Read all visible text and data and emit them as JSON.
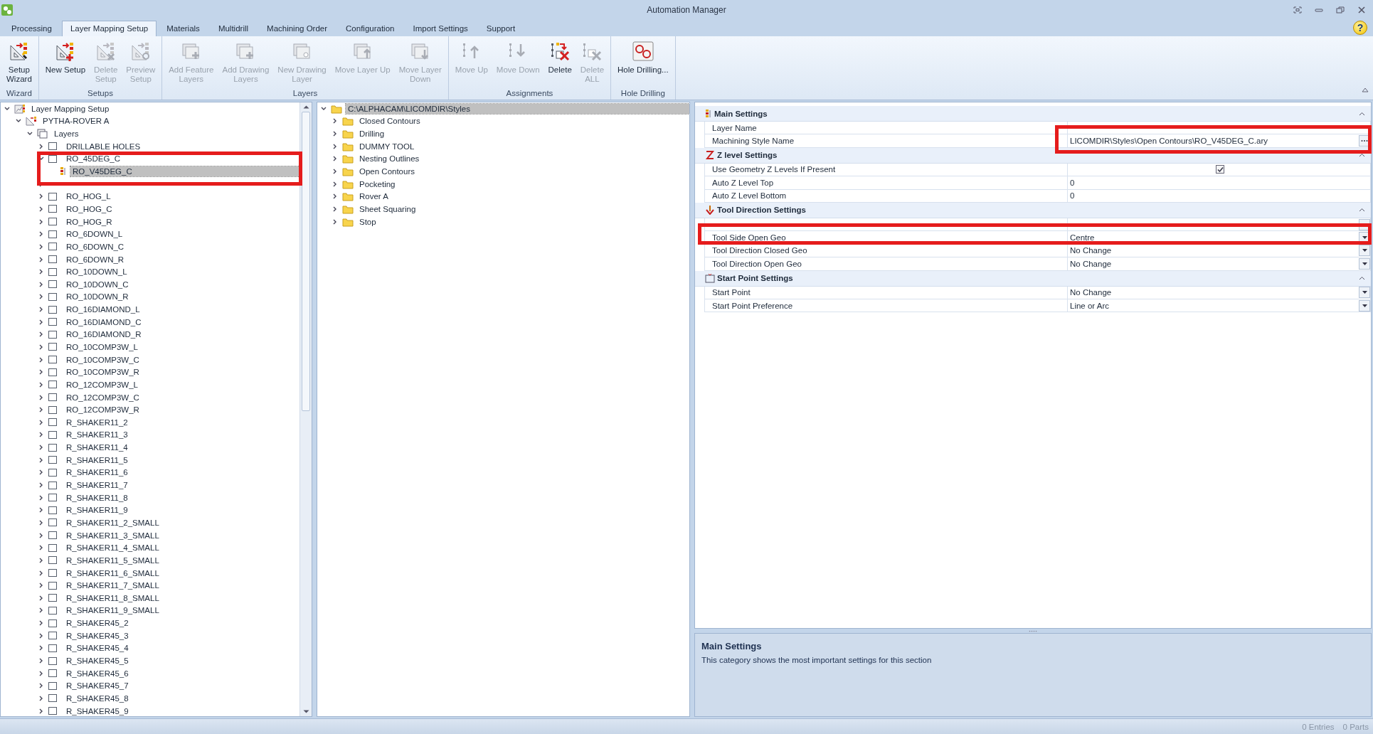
{
  "window": {
    "title": "Automation Manager"
  },
  "help": "?",
  "tabs": [
    {
      "label": "Processing",
      "selected": false
    },
    {
      "label": "Layer Mapping Setup",
      "selected": true
    },
    {
      "label": "Materials",
      "selected": false
    },
    {
      "label": "Multidrill",
      "selected": false
    },
    {
      "label": "Machining Order",
      "selected": false
    },
    {
      "label": "Configuration",
      "selected": false
    },
    {
      "label": "Import Settings",
      "selected": false
    },
    {
      "label": "Support",
      "selected": false
    }
  ],
  "ribbon": [
    {
      "caption": "Wizard",
      "buttons": [
        {
          "lines": [
            "Setup",
            "Wizard"
          ],
          "kind": "wizard",
          "disabled": false
        }
      ]
    },
    {
      "caption": "Setups",
      "buttons": [
        {
          "lines": [
            "New Setup"
          ],
          "kind": "new-setup",
          "disabled": false
        },
        {
          "lines": [
            "Delete",
            "Setup"
          ],
          "kind": "delete-setup",
          "disabled": true
        },
        {
          "lines": [
            "Preview",
            "Setup"
          ],
          "kind": "preview-setup",
          "disabled": true
        }
      ]
    },
    {
      "caption": "Layers",
      "buttons": [
        {
          "lines": [
            "Add Feature",
            "Layers"
          ],
          "kind": "add-layer",
          "disabled": true
        },
        {
          "lines": [
            "Add Drawing",
            "Layers"
          ],
          "kind": "add-layer",
          "disabled": true
        },
        {
          "lines": [
            "New Drawing",
            "Layer"
          ],
          "kind": "new-layer",
          "disabled": true
        },
        {
          "lines": [
            "Move Layer Up"
          ],
          "kind": "layer-up",
          "disabled": true
        },
        {
          "lines": [
            "Move Layer",
            "Down"
          ],
          "kind": "layer-down",
          "disabled": true
        }
      ]
    },
    {
      "caption": "Assignments",
      "buttons": [
        {
          "lines": [
            "Move Up"
          ],
          "kind": "move-up",
          "disabled": true
        },
        {
          "lines": [
            "Move Down"
          ],
          "kind": "move-down",
          "disabled": true
        },
        {
          "lines": [
            "Delete"
          ],
          "kind": "delete",
          "disabled": false
        },
        {
          "lines": [
            "Delete",
            "ALL"
          ],
          "kind": "delete-all",
          "disabled": true
        }
      ]
    },
    {
      "caption": "Hole Drilling",
      "buttons": [
        {
          "lines": [
            "Hole Drilling..."
          ],
          "kind": "holes",
          "disabled": false
        }
      ]
    }
  ],
  "layer_tree": {
    "label": "Layer Mapping Setup",
    "kind": "root",
    "expanded": true,
    "selected": false,
    "children": [
      {
        "label": "PYTHA-ROVER A",
        "kind": "setup",
        "expanded": true,
        "selected": false,
        "children": [
          {
            "label": "Layers",
            "kind": "layers",
            "expanded": true,
            "selected": false,
            "children": [
              {
                "label": "DRILLABLE HOLES",
                "kind": "layer",
                "expanded": false,
                "selected": false,
                "checked": false
              },
              {
                "label": "RO_45DEG_C",
                "kind": "layer",
                "expanded": true,
                "selected": false,
                "checked": false,
                "children": [
                  {
                    "label": "RO_V45DEG_C",
                    "kind": "style",
                    "selected": true
                  }
                ]
              },
              {
                "kind": "hidden-layer",
                "expanded": false
              },
              {
                "label": "RO_HOG_L",
                "kind": "layer",
                "expanded": false,
                "selected": false,
                "checked": false
              },
              {
                "label": "RO_HOG_C",
                "kind": "layer",
                "expanded": false,
                "selected": false,
                "checked": false
              },
              {
                "label": "RO_HOG_R",
                "kind": "layer",
                "expanded": false,
                "selected": false,
                "checked": false
              },
              {
                "label": "RO_6DOWN_L",
                "kind": "layer",
                "expanded": false,
                "selected": false,
                "checked": false
              },
              {
                "label": "RO_6DOWN_C",
                "kind": "layer",
                "expanded": false,
                "selected": false,
                "checked": false
              },
              {
                "label": "RO_6DOWN_R",
                "kind": "layer",
                "expanded": false,
                "selected": false,
                "checked": false
              },
              {
                "label": "RO_10DOWN_L",
                "kind": "layer",
                "expanded": false,
                "selected": false,
                "checked": false
              },
              {
                "label": "RO_10DOWN_C",
                "kind": "layer",
                "expanded": false,
                "selected": false,
                "checked": false
              },
              {
                "label": "RO_10DOWN_R",
                "kind": "layer",
                "expanded": false,
                "selected": false,
                "checked": false
              },
              {
                "label": "RO_16DIAMOND_L",
                "kind": "layer",
                "expanded": false,
                "selected": false,
                "checked": false
              },
              {
                "label": "RO_16DIAMOND_C",
                "kind": "layer",
                "expanded": false,
                "selected": false,
                "checked": false
              },
              {
                "label": "RO_16DIAMOND_R",
                "kind": "layer",
                "expanded": false,
                "selected": false,
                "checked": false
              },
              {
                "label": "RO_10COMP3W_L",
                "kind": "layer",
                "expanded": false,
                "selected": false,
                "checked": false
              },
              {
                "label": "RO_10COMP3W_C",
                "kind": "layer",
                "expanded": false,
                "selected": false,
                "checked": false
              },
              {
                "label": "RO_10COMP3W_R",
                "kind": "layer",
                "expanded": false,
                "selected": false,
                "checked": false
              },
              {
                "label": "RO_12COMP3W_L",
                "kind": "layer",
                "expanded": false,
                "selected": false,
                "checked": false
              },
              {
                "label": "RO_12COMP3W_C",
                "kind": "layer",
                "expanded": false,
                "selected": false,
                "checked": false
              },
              {
                "label": "RO_12COMP3W_R",
                "kind": "layer",
                "expanded": false,
                "selected": false,
                "checked": false
              },
              {
                "label": "R_SHAKER11_2",
                "kind": "layer",
                "expanded": false,
                "selected": false,
                "checked": false
              },
              {
                "label": "R_SHAKER11_3",
                "kind": "layer",
                "expanded": false,
                "selected": false,
                "checked": false
              },
              {
                "label": "R_SHAKER11_4",
                "kind": "layer",
                "expanded": false,
                "selected": false,
                "checked": false
              },
              {
                "label": "R_SHAKER11_5",
                "kind": "layer",
                "expanded": false,
                "selected": false,
                "checked": false
              },
              {
                "label": "R_SHAKER11_6",
                "kind": "layer",
                "expanded": false,
                "selected": false,
                "checked": false
              },
              {
                "label": "R_SHAKER11_7",
                "kind": "layer",
                "expanded": false,
                "selected": false,
                "checked": false
              },
              {
                "label": "R_SHAKER11_8",
                "kind": "layer",
                "expanded": false,
                "selected": false,
                "checked": false
              },
              {
                "label": "R_SHAKER11_9",
                "kind": "layer",
                "expanded": false,
                "selected": false,
                "checked": false
              },
              {
                "label": "R_SHAKER11_2_SMALL",
                "kind": "layer",
                "expanded": false,
                "selected": false,
                "checked": false
              },
              {
                "label": "R_SHAKER11_3_SMALL",
                "kind": "layer",
                "expanded": false,
                "selected": false,
                "checked": false
              },
              {
                "label": "R_SHAKER11_4_SMALL",
                "kind": "layer",
                "expanded": false,
                "selected": false,
                "checked": false
              },
              {
                "label": "R_SHAKER11_5_SMALL",
                "kind": "layer",
                "expanded": false,
                "selected": false,
                "checked": false
              },
              {
                "label": "R_SHAKER11_6_SMALL",
                "kind": "layer",
                "expanded": false,
                "selected": false,
                "checked": false
              },
              {
                "label": "R_SHAKER11_7_SMALL",
                "kind": "layer",
                "expanded": false,
                "selected": false,
                "checked": false
              },
              {
                "label": "R_SHAKER11_8_SMALL",
                "kind": "layer",
                "expanded": false,
                "selected": false,
                "checked": false
              },
              {
                "label": "R_SHAKER11_9_SMALL",
                "kind": "layer",
                "expanded": false,
                "selected": false,
                "checked": false
              },
              {
                "label": "R_SHAKER45_2",
                "kind": "layer",
                "expanded": false,
                "selected": false,
                "checked": false
              },
              {
                "label": "R_SHAKER45_3",
                "kind": "layer",
                "expanded": false,
                "selected": false,
                "checked": false
              },
              {
                "label": "R_SHAKER45_4",
                "kind": "layer",
                "expanded": false,
                "selected": false,
                "checked": false
              },
              {
                "label": "R_SHAKER45_5",
                "kind": "layer",
                "expanded": false,
                "selected": false,
                "checked": false
              },
              {
                "label": "R_SHAKER45_6",
                "kind": "layer",
                "expanded": false,
                "selected": false,
                "checked": false
              },
              {
                "label": "R_SHAKER45_7",
                "kind": "layer",
                "expanded": false,
                "selected": false,
                "checked": false
              },
              {
                "label": "R_SHAKER45_8",
                "kind": "layer",
                "expanded": false,
                "selected": false,
                "checked": false
              },
              {
                "label": "R_SHAKER45_9",
                "kind": "layer",
                "expanded": false,
                "selected": false,
                "checked": false
              }
            ]
          }
        ]
      }
    ]
  },
  "styles_tree": {
    "label": "C:\\ALPHACAM\\LICOMDIR\\Styles",
    "kind": "folder",
    "expanded": true,
    "selected": true,
    "children": [
      {
        "label": "Closed Contours",
        "kind": "folder",
        "expanded": false,
        "selected": false
      },
      {
        "label": "Drilling",
        "kind": "folder",
        "expanded": false,
        "selected": false
      },
      {
        "label": "DUMMY TOOL",
        "kind": "folder",
        "expanded": false,
        "selected": false
      },
      {
        "label": "Nesting Outlines",
        "kind": "folder",
        "expanded": false,
        "selected": false
      },
      {
        "label": "Open Contours",
        "kind": "folder",
        "expanded": false,
        "selected": false
      },
      {
        "label": "Pocketing",
        "kind": "folder",
        "expanded": false,
        "selected": false
      },
      {
        "label": "Rover A",
        "kind": "folder",
        "expanded": false,
        "selected": false
      },
      {
        "label": "Sheet Squaring",
        "kind": "folder",
        "expanded": false,
        "selected": false
      },
      {
        "label": "Stop",
        "kind": "folder",
        "expanded": false,
        "selected": false
      }
    ]
  },
  "properties": [
    {
      "title": "Main Settings",
      "kind": "style",
      "expanded": true,
      "rows": [
        {
          "label": "Layer Name",
          "kind": "text"
        },
        {
          "label": "Machining Style Name",
          "value": "LICOMDIR\\Styles\\Open Contours\\RO_V45DEG_C.ary",
          "kind": "ellipsis"
        }
      ]
    },
    {
      "title": "Z level Settings",
      "kind": "z",
      "expanded": true,
      "rows": [
        {
          "label": "Use Geometry Z Levels If Present",
          "kind": "check",
          "checked": true
        },
        {
          "label": "Auto Z Level Top",
          "value": "0",
          "kind": "text"
        },
        {
          "label": "Auto Z Level Bottom",
          "value": "0",
          "kind": "text"
        }
      ]
    },
    {
      "title": "Tool Direction Settings",
      "kind": "tool",
      "expanded": true,
      "rows": [
        {
          "kind": "dropdown"
        },
        {
          "label": "Tool Side Open Geo",
          "value": "Centre",
          "kind": "dropdown"
        },
        {
          "label": "Tool Direction Closed Geo",
          "value": "No Change",
          "kind": "dropdown"
        },
        {
          "label": "Tool Direction Open Geo",
          "value": "No Change",
          "kind": "dropdown"
        }
      ]
    },
    {
      "title": "Start Point Settings",
      "kind": "start",
      "expanded": true,
      "rows": [
        {
          "label": "Start Point",
          "value": "No Change",
          "kind": "dropdown"
        },
        {
          "label": "Start Point Preference",
          "value": "Line or Arc",
          "kind": "dropdown"
        }
      ]
    }
  ],
  "description": {
    "title": "Main Settings",
    "text": "This category shows the most important settings for this section"
  },
  "status_bar": {
    "entries": "0 Entries",
    "parts": "0 Parts"
  },
  "highlight_frames": [
    {
      "kind": "frame"
    },
    {
      "kind": "frame"
    },
    {
      "kind": "frame"
    }
  ]
}
